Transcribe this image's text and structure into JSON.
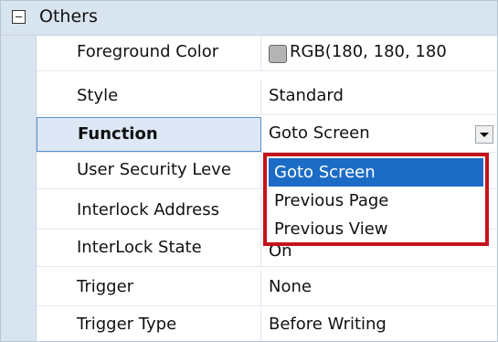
{
  "category": {
    "title": "Others",
    "expander": "minus-expander-icon"
  },
  "properties": [
    {
      "name": "Foreground Color",
      "value": "RGB(180, 180, 180"
    },
    {
      "name": "Style",
      "value": "Standard"
    },
    {
      "name": "Function",
      "value": "Goto Screen"
    },
    {
      "name": "User Security Leve",
      "value": ""
    },
    {
      "name": "Interlock Address",
      "value": ""
    },
    {
      "name": "InterLock State",
      "value": "On"
    },
    {
      "name": "Trigger",
      "value": "None"
    },
    {
      "name": "Trigger Type",
      "value": "Before Writing"
    }
  ],
  "foreground_swatch_color": "#b4b4b4",
  "function_dropdown": {
    "options": [
      "Goto Screen",
      "Previous Page",
      "Previous View"
    ],
    "selected": "Goto Screen",
    "highlight_color": "#1c6cc6",
    "outline_color": "#c4141b"
  }
}
